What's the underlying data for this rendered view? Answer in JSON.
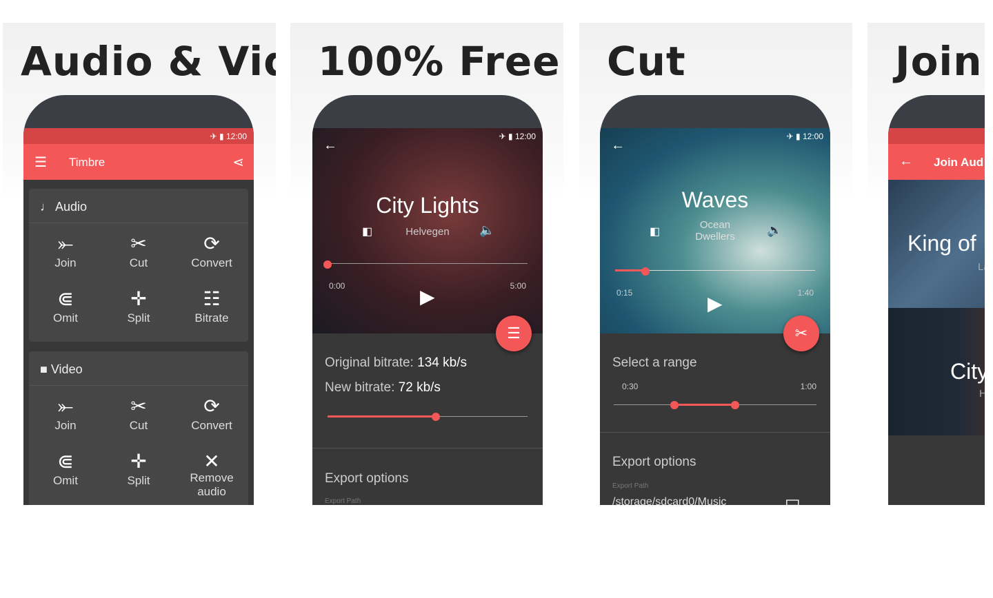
{
  "colors": {
    "accent": "#f45757",
    "status_bar": "#d64545",
    "background": "#383838"
  },
  "panels": [
    {
      "headline": "Audio & Video",
      "status_time": "12:00",
      "app_title": "Timbre",
      "audio_section": "Audio",
      "video_section": "Video",
      "audio_tools": [
        {
          "label": "Join",
          "icon": "join-icon"
        },
        {
          "label": "Cut",
          "icon": "scissors-icon"
        },
        {
          "label": "Convert",
          "icon": "convert-icon"
        },
        {
          "label": "Omit",
          "icon": "omit-icon"
        },
        {
          "label": "Split",
          "icon": "split-icon"
        },
        {
          "label": "Bitrate",
          "icon": "bitrate-icon"
        }
      ],
      "video_tools": [
        {
          "label": "Join",
          "icon": "join-icon"
        },
        {
          "label": "Cut",
          "icon": "scissors-icon"
        },
        {
          "label": "Convert",
          "icon": "convert-icon"
        },
        {
          "label": "Omit",
          "icon": "omit-icon"
        },
        {
          "label": "Split",
          "icon": "split-icon"
        },
        {
          "label": "Remove audio",
          "icon": "mute-icon"
        }
      ]
    },
    {
      "headline": "100% Free",
      "status_time": "12:00",
      "track_title": "City Lights",
      "track_artist": "Helvegen",
      "time_start": "0:00",
      "time_end": "5:00",
      "playback_progress": 0,
      "original_bitrate_label": "Original bitrate:",
      "original_bitrate": "134 kb/s",
      "new_bitrate_label": "New bitrate:",
      "new_bitrate": "72 kb/s",
      "bitrate_slider": 0.54,
      "export_options": "Export options",
      "export_path_label": "Export Path"
    },
    {
      "headline": "Cut",
      "status_time": "12:00",
      "track_title": "Waves",
      "track_artist": "Ocean Dwellers",
      "time_start": "0:15",
      "time_end": "1:40",
      "playback_progress": 0.15,
      "select_range": "Select a range",
      "range_start": "0:30",
      "range_end": "1:00",
      "export_options": "Export options",
      "export_path_label": "Export Path",
      "export_path": "/storage/sdcard0/Music"
    },
    {
      "headline": "Join",
      "app_title": "Join Aud",
      "track1_title": "King of",
      "track1_artist": "La",
      "track2_title": "City",
      "track2_artist": "H"
    }
  ]
}
